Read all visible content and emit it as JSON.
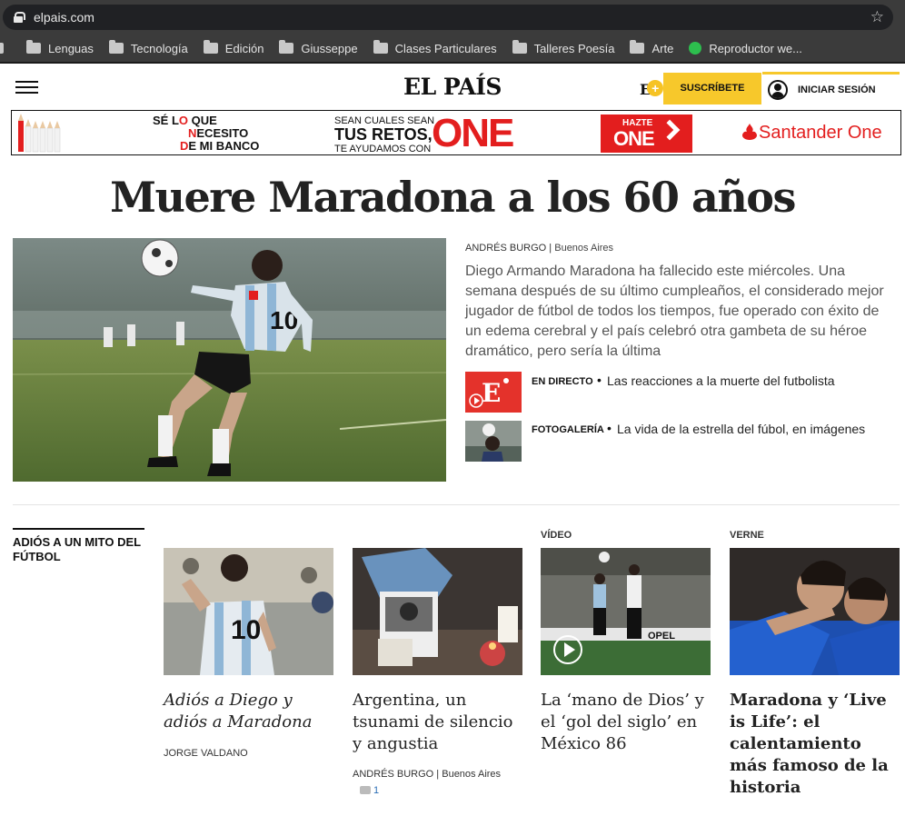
{
  "browser": {
    "url": "elpais.com",
    "bookmarks": [
      {
        "label": "",
        "type": "folder"
      },
      {
        "label": "Lenguas",
        "type": "folder"
      },
      {
        "label": "Tecnología",
        "type": "folder"
      },
      {
        "label": "Edición",
        "type": "folder"
      },
      {
        "label": "Giusseppe",
        "type": "folder"
      },
      {
        "label": "Clases Particulares",
        "type": "folder"
      },
      {
        "label": "Talleres Poesía",
        "type": "folder"
      },
      {
        "label": "Arte",
        "type": "folder"
      },
      {
        "label": "Reproductor we...",
        "type": "site"
      }
    ]
  },
  "header": {
    "logo": "EL PAÍS",
    "eplus": "E",
    "eplus_symbol": "+",
    "subscribe_label": "SUSCRÍBETE",
    "login_label": "INICIAR SESIÓN"
  },
  "ad": {
    "block1_line1_a": "SÉ L",
    "block1_line1_red": "O",
    "block1_line1_b": " QUE",
    "block1_line2_red": "N",
    "block1_line2_b": "ECESITO",
    "block1_line3_red": "D",
    "block1_line3_b": "E MI BANCO",
    "block2_line1": "SEAN CUALES SEAN",
    "block2_line2": "TUS RETOS,",
    "block2_line3": "TE AYUDAMOS CON",
    "one": "ONE",
    "hazte_l1": "HAZTE",
    "hazte_l2": "ONE",
    "brand": "Santander One"
  },
  "main": {
    "headline": "Muere Maradona a los 60 años",
    "byline_author": "ANDRÉS BURGO",
    "byline_sep": " | ",
    "byline_city": "Buenos Aires",
    "summary": "Diego Armando Maradona ha fallecido este miércoles. Una semana después de su último cumpleaños, el considerado mejor jugador de fútbol de todos los tiempos, fue operado con éxito de un edema cerebral y el país celebró otra gambeta de su héroe dramático, pero sería la última",
    "related": [
      {
        "tag": "EN DIRECTO",
        "text": "Las reacciones a la muerte del futbolista"
      },
      {
        "tag": "FOTOGALERÍA",
        "text": "La vida de la estrella del fúbol, en imágenes"
      }
    ]
  },
  "section": {
    "title": "ADIÓS A UN MITO DEL FÚTBOL",
    "cards": [
      {
        "kicker": "",
        "title": "Adiós a Diego y adiós a Maradona",
        "author": "JORGE VALDANO"
      },
      {
        "kicker": "",
        "title": "Argentina, un tsunami de silencio y angustia",
        "author": "ANDRÉS BURGO",
        "city": "Buenos Aires",
        "comments": "1"
      },
      {
        "kicker": "VÍDEO",
        "title": "La ‘mano de Dios’ y el ‘gol del siglo’ en México 86"
      },
      {
        "kicker": "VERNE",
        "title": "Maradona y ‘Live is Life’: el calentamiento más famoso de la historia"
      }
    ]
  },
  "colors": {
    "accent_yellow": "#f7c82b",
    "brand_red": "#e31e1e",
    "browser_bg": "#3b3b3b"
  }
}
